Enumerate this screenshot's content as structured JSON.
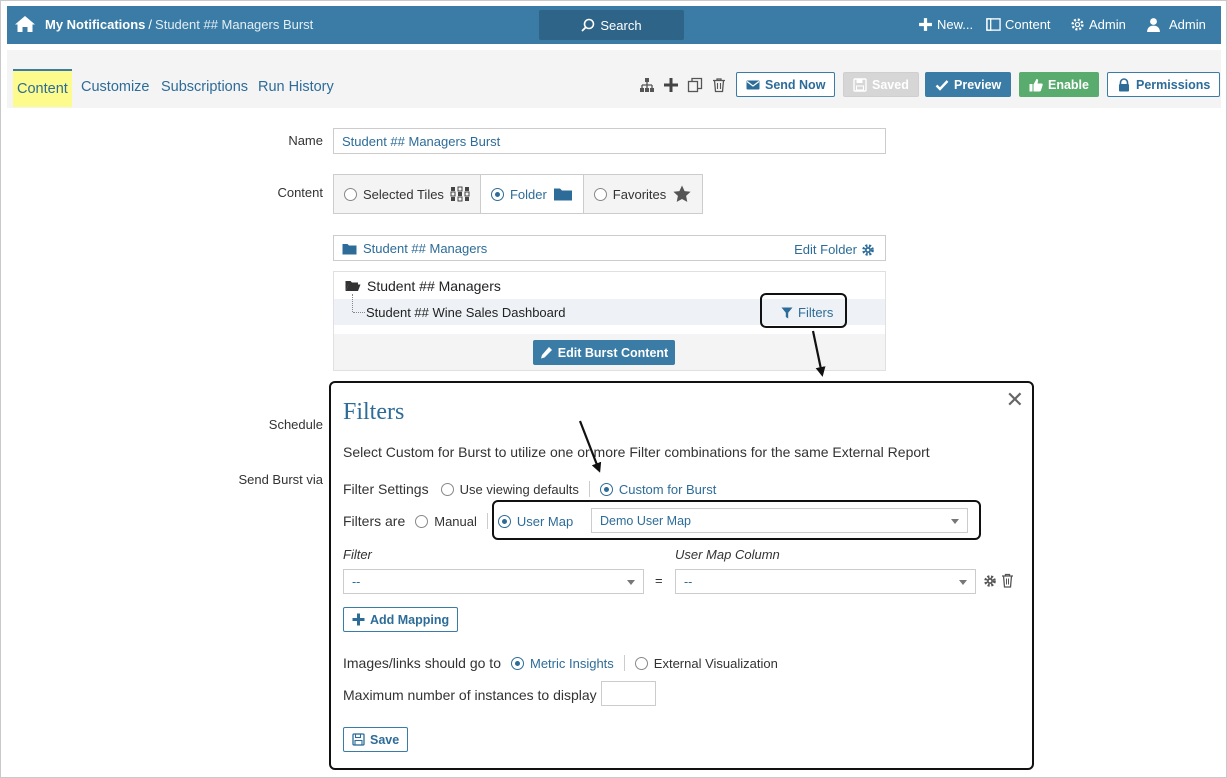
{
  "topbar": {
    "breadcrumb_root": "My Notifications",
    "breadcrumb_sep": "/",
    "breadcrumb_current": "Student ## Managers Burst",
    "search_label": "Search",
    "new_label": "New...",
    "content_label": "Content",
    "admin_menu_label": "Admin",
    "user_label": "Admin"
  },
  "tabs": [
    {
      "label": "Content",
      "active": true
    },
    {
      "label": "Customize"
    },
    {
      "label": "Subscriptions"
    },
    {
      "label": "Run History"
    }
  ],
  "toolbar": {
    "send_now": "Send Now",
    "saved": "Saved",
    "preview": "Preview",
    "enable": "Enable",
    "permissions": "Permissions"
  },
  "form": {
    "name_label": "Name",
    "name_value": "Student ## Managers Burst",
    "content_label": "Content",
    "content_options": [
      {
        "label": "Selected Tiles",
        "selected": false
      },
      {
        "label": "Folder",
        "selected": true
      },
      {
        "label": "Favorites",
        "selected": false
      }
    ],
    "folder_name": "Student ## Managers",
    "edit_folder": "Edit Folder",
    "tree_root": "Student ## Managers",
    "tree_child": "Student ## Wine Sales Dashboard",
    "filters_link": "Filters",
    "edit_burst_content": "Edit Burst Content",
    "schedule_label": "Schedule",
    "send_burst_label": "Send Burst via"
  },
  "modal": {
    "title": "Filters",
    "description": "Select Custom for Burst to utilize one or more Filter combinations for the same External Report",
    "filter_settings_label": "Filter Settings",
    "filter_settings_options": [
      {
        "label": "Use viewing defaults",
        "selected": false
      },
      {
        "label": "Custom for Burst",
        "selected": true
      }
    ],
    "filters_are_label": "Filters are",
    "filters_are_options": [
      {
        "label": "Manual",
        "selected": false
      },
      {
        "label": "User Map",
        "selected": true
      }
    ],
    "user_map_value": "Demo User Map",
    "filter_header": "Filter",
    "user_map_column_header": "User Map Column",
    "filter_value": "--",
    "equals": "=",
    "column_value": "--",
    "add_mapping": "Add Mapping",
    "images_links_label": "Images/links should go to",
    "images_links_options": [
      {
        "label": "Metric Insights",
        "selected": true
      },
      {
        "label": "External Visualization",
        "selected": false
      }
    ],
    "max_instances_label": "Maximum number of instances to display",
    "max_instances_value": "",
    "save": "Save"
  },
  "colors": {
    "primary": "#3a7ca5",
    "link": "#2d6c98",
    "enable_green": "#5aac6e",
    "active_tab_highlight": "#fdfb8c"
  }
}
